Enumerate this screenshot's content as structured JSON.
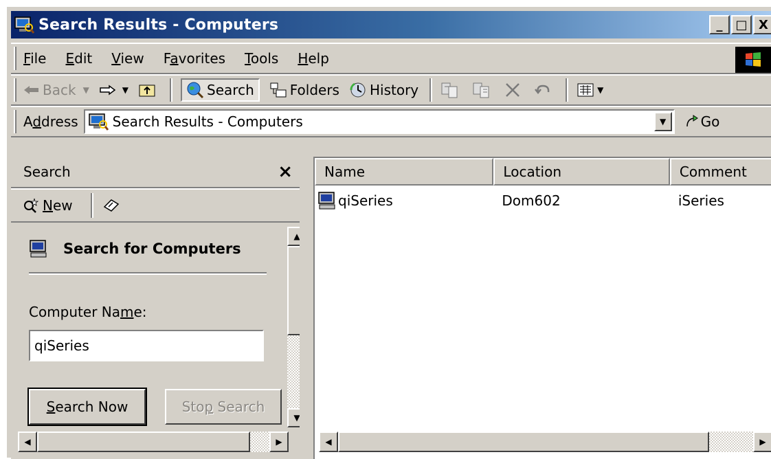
{
  "window": {
    "title": "Search Results - Computers",
    "controls": {
      "minimize": "_",
      "maximize": "□",
      "close": "X"
    }
  },
  "menu": {
    "items": [
      {
        "pre": "",
        "key": "F",
        "post": "ile"
      },
      {
        "pre": "",
        "key": "E",
        "post": "dit"
      },
      {
        "pre": "",
        "key": "V",
        "post": "iew"
      },
      {
        "pre": "F",
        "key": "a",
        "post": "vorites"
      },
      {
        "pre": "",
        "key": "T",
        "post": "ools"
      },
      {
        "pre": "",
        "key": "H",
        "post": "elp"
      }
    ]
  },
  "toolbar": {
    "back": "Back",
    "search": "Search",
    "folders": "Folders",
    "history": "History"
  },
  "address": {
    "label_pre": "A",
    "label_key": "d",
    "label_post": "dress",
    "value": "Search Results - Computers",
    "go": "Go"
  },
  "search_pane": {
    "title": "Search",
    "close": "×",
    "new_key": "N",
    "new_post": "ew",
    "heading": "Search for Computers",
    "field_label_pre": "Computer Na",
    "field_label_key": "m",
    "field_label_post": "e:",
    "field_value": "qiSeries",
    "search_now_key": "S",
    "search_now_post": "earch Now",
    "stop_pre": "Sto",
    "stop_key": "p",
    "stop_post": " Search"
  },
  "results": {
    "columns": [
      "Name",
      "Location",
      "Comment"
    ],
    "rows": [
      {
        "name": "qiSeries",
        "location": "Dom602",
        "comment": "iSeries"
      }
    ]
  },
  "colors": {
    "face": "#d4d0c8",
    "titlebar_start": "#0a246a",
    "titlebar_end": "#a6caf0"
  }
}
